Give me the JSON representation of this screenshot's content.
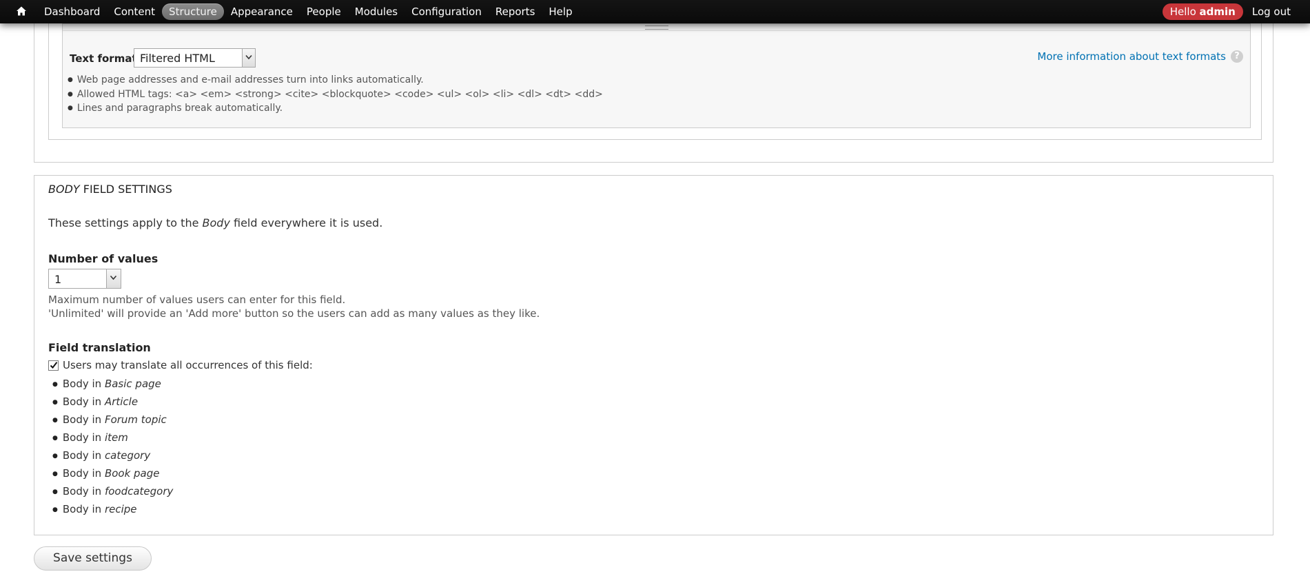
{
  "toolbar": {
    "nav": [
      "Dashboard",
      "Content",
      "Structure",
      "Appearance",
      "People",
      "Modules",
      "Configuration",
      "Reports",
      "Help"
    ],
    "active_nav": "Structure",
    "hello_prefix": "Hello",
    "username": "admin",
    "logout": "Log out",
    "colors": {
      "bar": "#101010",
      "hello_badge": "#c8363a"
    }
  },
  "text_format": {
    "label": "Text format",
    "selected": "Filtered HTML",
    "more_info_link": "More information about text formats",
    "help_icon_glyph": "?",
    "tips": [
      "Web page addresses and e-mail addresses turn into links automatically.",
      "Allowed HTML tags: <a> <em> <strong> <cite> <blockquote> <code> <ul> <ol> <li> <dl> <dt> <dd>",
      "Lines and paragraphs break automatically."
    ]
  },
  "body_settings": {
    "legend_italic": "Body",
    "legend_rest": " field settings",
    "desc_before": "These settings apply to the ",
    "desc_italic": "Body",
    "desc_after": " field everywhere it is used.",
    "number_of_values": {
      "label": "Number of values",
      "selected": "1",
      "desc_line1": "Maximum number of values users can enter for this field.",
      "desc_line2": "'Unlimited' will provide an 'Add more' button so the users can add as many values as they like."
    },
    "field_translation": {
      "label": "Field translation",
      "checkbox_checked": true,
      "checkbox_label": "Users may translate all occurrences of this field:",
      "prefix": "Body in ",
      "bundles": [
        "Basic page",
        "Article",
        "Forum topic",
        "item",
        "category",
        "Book page",
        "foodcategory",
        "recipe"
      ]
    }
  },
  "save_button": "Save settings",
  "link_color": "#0071b3"
}
